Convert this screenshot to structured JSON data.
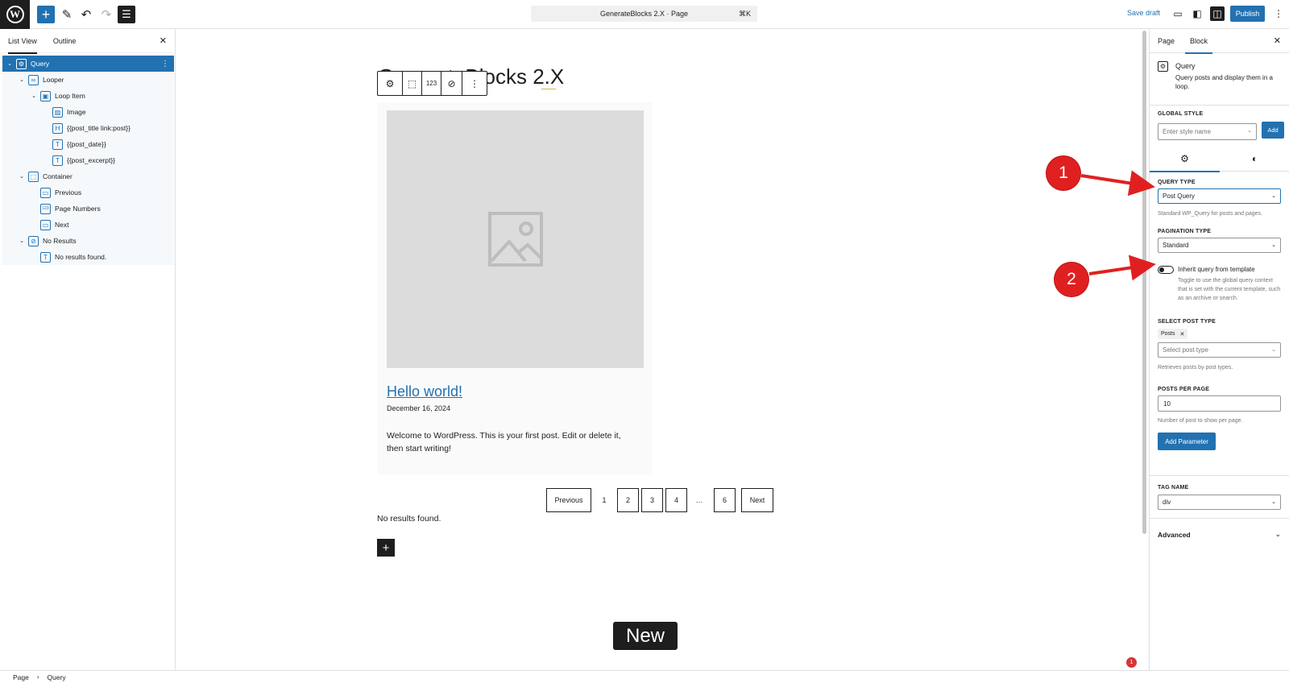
{
  "topbar": {
    "document_title": "GenerateBlocks 2.X · Page",
    "shortcut": "⌘K",
    "save_draft": "Save draft",
    "publish": "Publish"
  },
  "left_panel": {
    "tabs": [
      "List View",
      "Outline"
    ],
    "tree": [
      {
        "label": "Query",
        "depth": 0,
        "icon": "query-icon",
        "glyph": "⚙",
        "chevron": true,
        "selected": true
      },
      {
        "label": "Looper",
        "depth": 1,
        "icon": "looper-icon",
        "glyph": "∞",
        "chevron": true
      },
      {
        "label": "Loop Item",
        "depth": 2,
        "icon": "loop-item-icon",
        "glyph": "▣",
        "chevron": true
      },
      {
        "label": "Image",
        "depth": 3,
        "icon": "image-icon",
        "glyph": "▨",
        "chevron": false
      },
      {
        "label": "{{post_title link:post}}",
        "depth": 3,
        "icon": "heading-icon",
        "glyph": "H",
        "chevron": false
      },
      {
        "label": "{{post_date}}",
        "depth": 3,
        "icon": "text-icon",
        "glyph": "T",
        "chevron": false
      },
      {
        "label": "{{post_excerpt}}",
        "depth": 3,
        "icon": "text-icon",
        "glyph": "T",
        "chevron": false
      },
      {
        "label": "Container",
        "depth": 1,
        "icon": "container-icon",
        "glyph": "⬚",
        "chevron": true
      },
      {
        "label": "Previous",
        "depth": 2,
        "icon": "button-icon",
        "glyph": "▭",
        "chevron": false
      },
      {
        "label": "Page Numbers",
        "depth": 2,
        "icon": "page-numbers-icon",
        "glyph": "123",
        "chevron": false
      },
      {
        "label": "Next",
        "depth": 2,
        "icon": "button-icon",
        "glyph": "▭",
        "chevron": false
      },
      {
        "label": "No Results",
        "depth": 1,
        "icon": "no-results-icon",
        "glyph": "⊘",
        "chevron": true
      },
      {
        "label": "No results found.",
        "depth": 2,
        "icon": "text-icon",
        "glyph": "T",
        "chevron": false
      }
    ]
  },
  "canvas": {
    "page_title": "GenerateBlocks 2.X",
    "post_title": "Hello world!",
    "post_date": "December 16, 2024",
    "post_excerpt": "Welcome to WordPress. This is your first post. Edit or delete it, then start writing!",
    "pagination": {
      "previous": "Previous",
      "pages": [
        "1",
        "2",
        "3",
        "4",
        "…",
        "6"
      ],
      "current": "1",
      "next": "Next"
    },
    "no_results": "No results found.",
    "new_badge": "New",
    "notification_count": "1"
  },
  "right_panel": {
    "tabs": [
      "Page",
      "Block"
    ],
    "active_tab": "Block",
    "block_name": "Query",
    "block_description": "Query posts and display them in a loop.",
    "global_style_label": "GLOBAL STYLE",
    "global_style_placeholder": "Enter style name",
    "global_style_add": "Add",
    "query_type_label": "QUERY TYPE",
    "query_type_value": "Post Query",
    "query_type_help": "Standard WP_Query for posts and pages.",
    "pagination_type_label": "PAGINATION TYPE",
    "pagination_type_value": "Standard",
    "inherit_label": "Inherit query from template",
    "inherit_help": "Toggle to use the global query context that is set with the current template, such as an archive or search.",
    "inherit_on": false,
    "post_type_label": "SELECT POST TYPE",
    "post_type_token": "Posts",
    "post_type_placeholder": "Select post type",
    "post_type_help": "Retrieves posts by post types.",
    "posts_per_page_label": "POSTS PER PAGE",
    "posts_per_page_value": "10",
    "posts_per_page_help": "Number of post to show per page.",
    "add_parameter": "Add Parameter",
    "tag_name_label": "TAG NAME",
    "tag_name_value": "div",
    "advanced": "Advanced"
  },
  "annotations": [
    "1",
    "2"
  ],
  "breadcrumb": [
    "Page",
    "Query"
  ],
  "colors": {
    "accent": "#2271b1",
    "dark": "#1e1e1e",
    "annotation": "#e02020",
    "danger": "#d63638"
  }
}
